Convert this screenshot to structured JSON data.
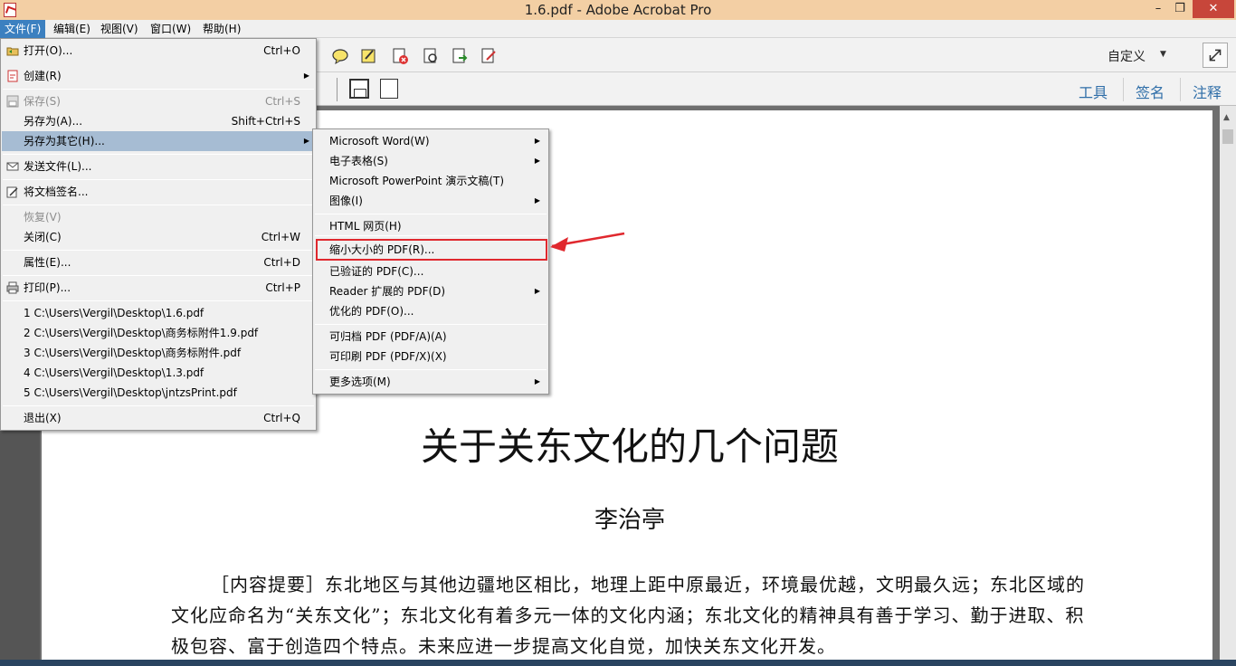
{
  "window": {
    "title": "1.6.pdf - Adobe Acrobat Pro",
    "min": "–",
    "max": "❐",
    "close": "✕"
  },
  "menubar": [
    "文件(F)",
    "编辑(E)",
    "视图(V)",
    "窗口(W)",
    "帮助(H)"
  ],
  "toolbar": {
    "customize": "自定义",
    "tabs": [
      "工具",
      "签名",
      "注释"
    ]
  },
  "file_menu": {
    "open": {
      "label": "打开(O)...",
      "shortcut": "Ctrl+O"
    },
    "create": {
      "label": "创建(R)"
    },
    "save": {
      "label": "保存(S)",
      "shortcut": "Ctrl+S"
    },
    "save_as": {
      "label": "另存为(A)...",
      "shortcut": "Shift+Ctrl+S"
    },
    "save_as_other": {
      "label": "另存为其它(H)..."
    },
    "send_file": {
      "label": "发送文件(L)..."
    },
    "sign_doc": {
      "label": "将文档签名..."
    },
    "revert": {
      "label": "恢复(V)"
    },
    "close": {
      "label": "关闭(C)",
      "shortcut": "Ctrl+W"
    },
    "properties": {
      "label": "属性(E)...",
      "shortcut": "Ctrl+D"
    },
    "print": {
      "label": "打印(P)...",
      "shortcut": "Ctrl+P"
    },
    "recent": [
      "1 C:\\Users\\Vergil\\Desktop\\1.6.pdf",
      "2 C:\\Users\\Vergil\\Desktop\\商务标附件1.9.pdf",
      "3 C:\\Users\\Vergil\\Desktop\\商务标附件.pdf",
      "4 C:\\Users\\Vergil\\Desktop\\1.3.pdf",
      "5 C:\\Users\\Vergil\\Desktop\\jntzsPrint.pdf"
    ],
    "exit": {
      "label": "退出(X)",
      "shortcut": "Ctrl+Q"
    }
  },
  "save_as_submenu": {
    "word": "Microsoft Word(W)",
    "spreadsheet": "电子表格(S)",
    "powerpoint": "Microsoft PowerPoint 演示文稿(T)",
    "image": "图像(I)",
    "html": "HTML 网页(H)",
    "reduced_pdf": "缩小大小的 PDF(R)...",
    "certified_pdf": "已验证的 PDF(C)...",
    "reader_extended": "Reader 扩展的 PDF(D)",
    "optimized_pdf": "优化的 PDF(O)...",
    "archivable_pdf": "可归档 PDF (PDF/A)(A)",
    "printable_pdf": "可印刷 PDF (PDF/X)(X)",
    "more_options": "更多选项(M)"
  },
  "document": {
    "title": "关于关东文化的几个问题",
    "author": "李治亭",
    "abstract": "［内容提要］东北地区与其他边疆地区相比，地理上距中原最近，环境最优越，文明最久远；东北区域的文化应命名为“关东文化”；东北文化有着多元一体的文化内涵；东北文化的精神具有善于学习、勤于进取、积极包容、富于创造四个特点。未来应进一步提高文化自觉，加快关东文化开发。"
  }
}
